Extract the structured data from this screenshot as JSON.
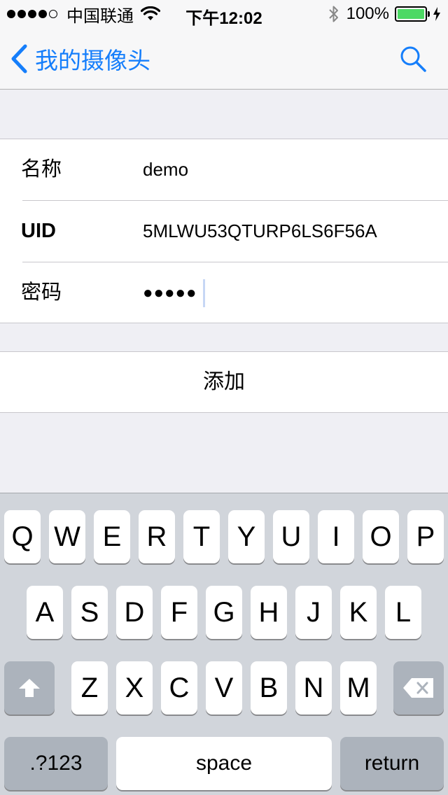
{
  "status_bar": {
    "carrier": "中国联通",
    "time": "下午12:02",
    "battery_percent": "100%",
    "battery_level": 1.0,
    "signal_bars": 4,
    "signal_max": 5
  },
  "nav": {
    "back_label": "我的摄像头",
    "accent_color": "#157efb"
  },
  "form": {
    "name_label": "名称",
    "name_value": "demo",
    "uid_label": "UID",
    "uid_value": "5MLWU53QTURP6LS6F56A",
    "password_label": "密码",
    "password_value": "●●●●●"
  },
  "add_button_label": "添加",
  "keyboard": {
    "row1": [
      "Q",
      "W",
      "E",
      "R",
      "T",
      "Y",
      "U",
      "I",
      "O",
      "P"
    ],
    "row2": [
      "A",
      "S",
      "D",
      "F",
      "G",
      "H",
      "J",
      "K",
      "L"
    ],
    "row3": [
      "Z",
      "X",
      "C",
      "V",
      "B",
      "N",
      "M"
    ],
    "numbers_label": ".?123",
    "space_label": "space",
    "return_label": "return"
  }
}
